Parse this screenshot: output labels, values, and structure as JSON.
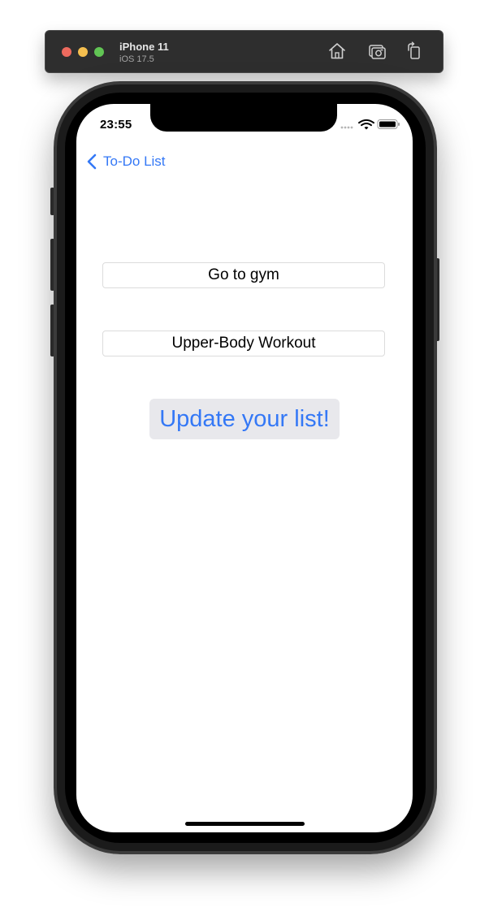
{
  "simulator": {
    "device_name": "iPhone 11",
    "os_version": "iOS 17.5",
    "toolbar_icons": [
      "home-icon",
      "screenshot-icon",
      "rotate-icon"
    ]
  },
  "status_bar": {
    "time": "23:55",
    "icons": [
      "cellular-signal-icon",
      "wifi-icon",
      "battery-icon"
    ]
  },
  "navigation": {
    "back_label": "To-Do List",
    "back_icon": "chevron-left-icon"
  },
  "form": {
    "task_value": "Go to gym",
    "detail_value": "Upper-Body Workout",
    "update_button_label": "Update your list!"
  },
  "colors": {
    "accent": "#3478f6",
    "button_background": "#e8e8ec",
    "field_border": "#dcdcdc"
  }
}
